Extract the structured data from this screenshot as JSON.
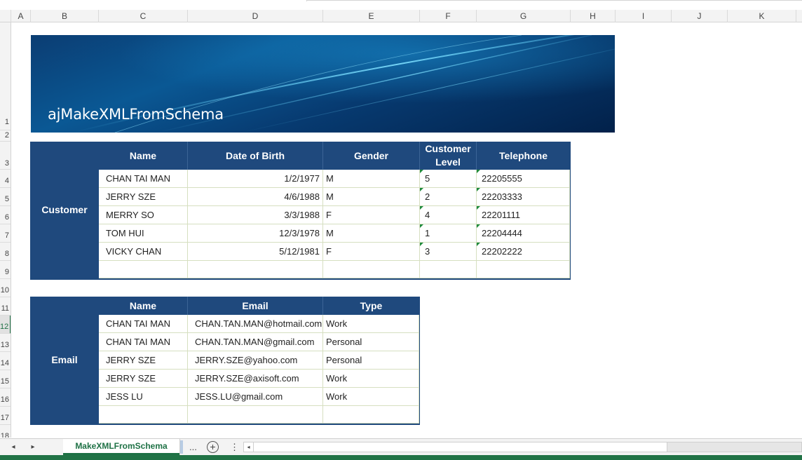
{
  "columns": [
    "A",
    "B",
    "C",
    "D",
    "E",
    "F",
    "G",
    "H",
    "I",
    "J",
    "K"
  ],
  "rows": [
    "1",
    "2",
    "3",
    "4",
    "5",
    "6",
    "7",
    "8",
    "9",
    "10",
    "11",
    "12",
    "13",
    "14",
    "15",
    "16",
    "17",
    "18"
  ],
  "selected_row": "12",
  "banner": {
    "title": "ajMakeXMLFromSchema"
  },
  "customer_table": {
    "label": "Customer",
    "headers": [
      "Name",
      "Date of Birth",
      "Gender",
      "Customer Level",
      "Telephone"
    ],
    "rows": [
      [
        "CHAN TAI MAN",
        "1/2/1977",
        "M",
        "5",
        "22205555"
      ],
      [
        "JERRY SZE",
        "4/6/1988",
        "M",
        "2",
        "22203333"
      ],
      [
        "MERRY SO",
        "3/3/1988",
        "F",
        "4",
        "22201111"
      ],
      [
        "TOM HUI",
        "12/3/1978",
        "M",
        "1",
        "22204444"
      ],
      [
        "VICKY CHAN",
        "5/12/1981",
        "F",
        "3",
        "22202222"
      ],
      [
        "",
        "",
        "",
        "",
        ""
      ]
    ]
  },
  "email_table": {
    "label": "Email",
    "headers": [
      "Name",
      "Email",
      "Type"
    ],
    "rows": [
      [
        "CHAN TAI MAN",
        "CHAN.TAN.MAN@hotmail.com",
        "Work"
      ],
      [
        "CHAN TAI MAN",
        "CHAN.TAN.MAN@gmail.com",
        "Personal"
      ],
      [
        "JERRY SZE",
        "JERRY.SZE@yahoo.com",
        "Personal"
      ],
      [
        "JERRY SZE",
        "JERRY.SZE@axisoft.com",
        "Work"
      ],
      [
        "JESS LU",
        "JESS.LU@gmail.com",
        "Work"
      ],
      [
        "",
        "",
        ""
      ]
    ]
  },
  "sheet_bar": {
    "prev_icon": "◂",
    "next_icon": "▸",
    "active_tab": "MakeXMLFromSchema",
    "more_tabs": "...",
    "add_sheet_icon": "+",
    "options_icon": "⋮",
    "scroll_left_icon": "◂"
  },
  "colors": {
    "header_blue": "#1f497d",
    "excel_green": "#217346",
    "gridline": "#d6dfc0"
  }
}
